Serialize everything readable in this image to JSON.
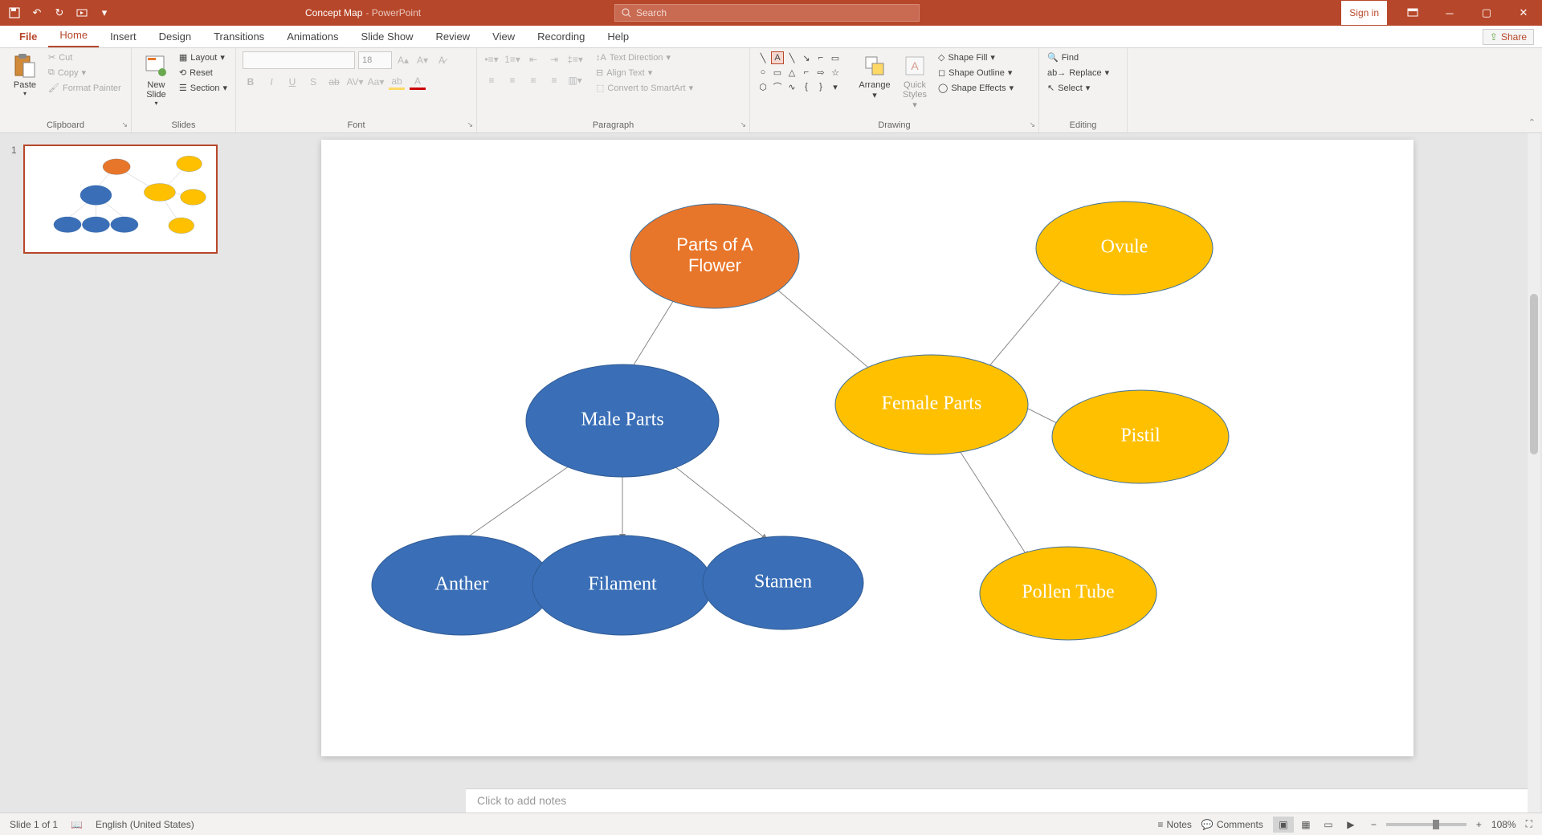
{
  "titlebar": {
    "doc_name": "Concept Map",
    "app_name": "PowerPoint",
    "search_placeholder": "Search",
    "signin": "Sign in"
  },
  "tabs": {
    "file": "File",
    "home": "Home",
    "insert": "Insert",
    "design": "Design",
    "transitions": "Transitions",
    "animations": "Animations",
    "slideshow": "Slide Show",
    "review": "Review",
    "view": "View",
    "recording": "Recording",
    "help": "Help",
    "share": "Share"
  },
  "ribbon": {
    "clipboard": {
      "label": "Clipboard",
      "paste": "Paste",
      "cut": "Cut",
      "copy": "Copy",
      "format_painter": "Format Painter"
    },
    "slides": {
      "label": "Slides",
      "new_slide": "New\nSlide",
      "layout": "Layout",
      "reset": "Reset",
      "section": "Section"
    },
    "font": {
      "label": "Font",
      "size": "18"
    },
    "paragraph": {
      "label": "Paragraph",
      "text_direction": "Text Direction",
      "align_text": "Align Text",
      "convert_smartart": "Convert to SmartArt"
    },
    "drawing": {
      "label": "Drawing",
      "arrange": "Arrange",
      "quick_styles": "Quick\nStyles",
      "shape_fill": "Shape Fill",
      "shape_outline": "Shape Outline",
      "shape_effects": "Shape Effects"
    },
    "editing": {
      "label": "Editing",
      "find": "Find",
      "replace": "Replace",
      "select": "Select"
    }
  },
  "slidepanel": {
    "num1": "1"
  },
  "concept_map": {
    "root": "Parts of A\nFlower",
    "male": "Male Parts",
    "anther": "Anther",
    "filament": "Filament",
    "stamen": "Stamen",
    "female": "Female Parts",
    "ovule": "Ovule",
    "pistil": "Pistil",
    "pollen_tube": "Pollen Tube"
  },
  "notes": {
    "placeholder": "Click to add notes"
  },
  "status": {
    "slide_count": "Slide 1 of 1",
    "language": "English (United States)",
    "notes_btn": "Notes",
    "comments_btn": "Comments",
    "zoom": "108%"
  }
}
